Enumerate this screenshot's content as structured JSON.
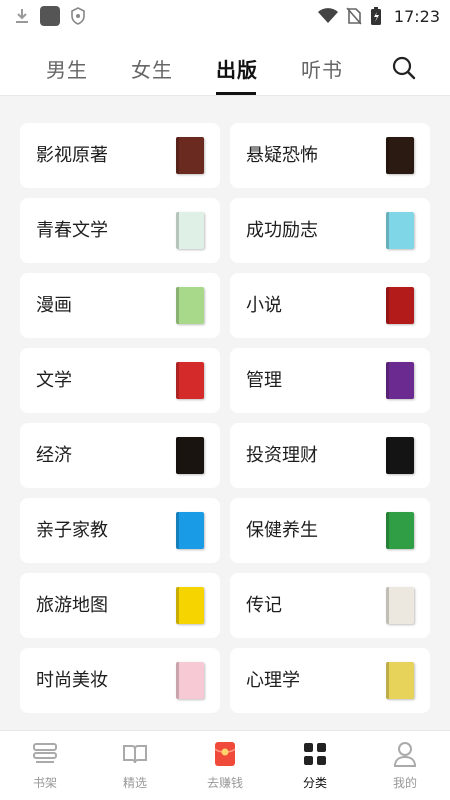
{
  "status_bar": {
    "time": "17:23"
  },
  "top_tabs": [
    {
      "label": "男生",
      "active": false
    },
    {
      "label": "女生",
      "active": false
    },
    {
      "label": "出版",
      "active": true
    },
    {
      "label": "听书",
      "active": false
    }
  ],
  "categories": [
    {
      "label": "影视原著",
      "cover_color": "#6b2a1f",
      "icon": "book-cover-icon"
    },
    {
      "label": "悬疑恐怖",
      "cover_color": "#2b1a12",
      "icon": "book-cover-icon"
    },
    {
      "label": "青春文学",
      "cover_color": "#dff0e6",
      "icon": "book-cover-icon"
    },
    {
      "label": "成功励志",
      "cover_color": "#7fd6e6",
      "icon": "book-cover-icon"
    },
    {
      "label": "漫画",
      "cover_color": "#a8d88a",
      "icon": "book-cover-icon"
    },
    {
      "label": "小说",
      "cover_color": "#b31b1b",
      "icon": "book-cover-icon"
    },
    {
      "label": "文学",
      "cover_color": "#d42a2a",
      "icon": "book-cover-icon"
    },
    {
      "label": "管理",
      "cover_color": "#6b2a8f",
      "icon": "book-cover-icon"
    },
    {
      "label": "经济",
      "cover_color": "#1a1410",
      "icon": "book-cover-icon"
    },
    {
      "label": "投资理财",
      "cover_color": "#141414",
      "icon": "book-cover-icon"
    },
    {
      "label": "亲子家教",
      "cover_color": "#1a9be6",
      "icon": "book-cover-icon"
    },
    {
      "label": "保健养生",
      "cover_color": "#2f9e44",
      "icon": "book-cover-icon"
    },
    {
      "label": "旅游地图",
      "cover_color": "#f5d400",
      "icon": "book-cover-icon"
    },
    {
      "label": "传记",
      "cover_color": "#ece8df",
      "icon": "book-cover-icon"
    },
    {
      "label": "时尚美妆",
      "cover_color": "#f7c9d4",
      "icon": "book-cover-icon"
    },
    {
      "label": "心理学",
      "cover_color": "#e7d35a",
      "icon": "book-cover-icon"
    }
  ],
  "bottom_nav": [
    {
      "label": "书架",
      "icon": "bookshelf-icon",
      "active": false
    },
    {
      "label": "精选",
      "icon": "open-book-icon",
      "active": false
    },
    {
      "label": "去赚钱",
      "icon": "red-envelope-icon",
      "active": false
    },
    {
      "label": "分类",
      "icon": "grid-icon",
      "active": true
    },
    {
      "label": "我的",
      "icon": "profile-icon",
      "active": false
    }
  ],
  "colors": {
    "accent": "#111111",
    "background": "#f4f4f4",
    "card": "#ffffff",
    "inactive_text": "#999999",
    "earn_red": "#f04b3a"
  }
}
